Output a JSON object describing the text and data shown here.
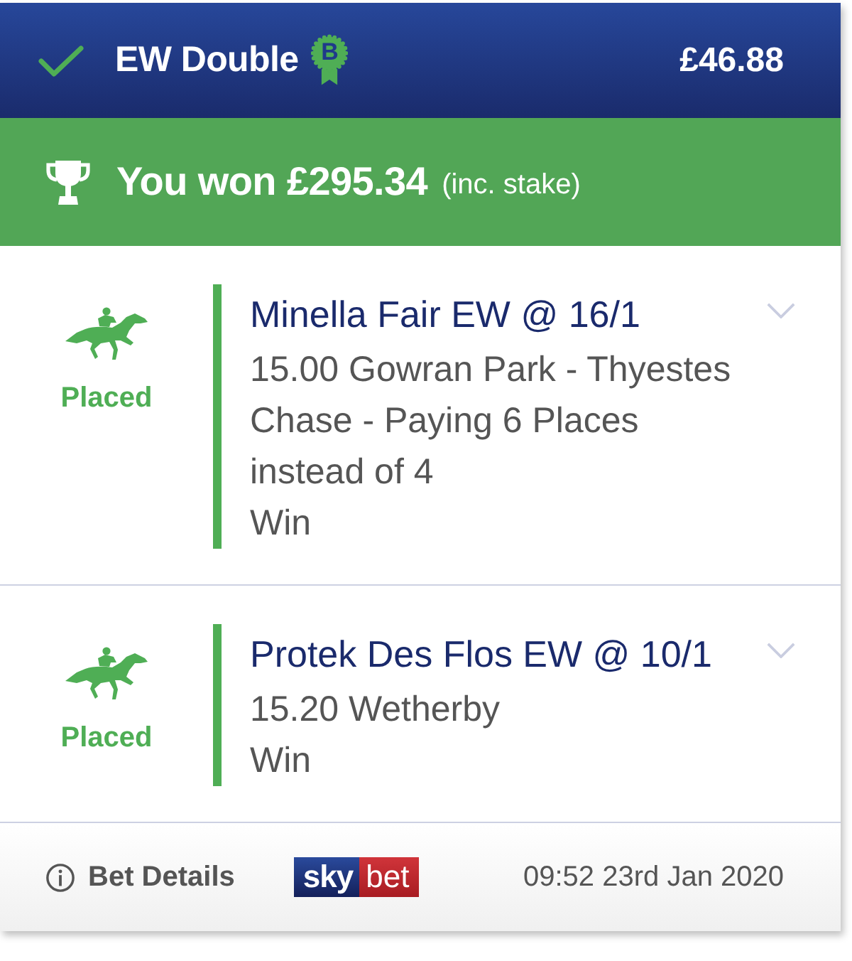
{
  "header": {
    "settled": true,
    "bet_type": "EW Double",
    "badge": "B",
    "total_stake": "£46.88"
  },
  "result_banner": {
    "headline": "You won £295.34",
    "note": "(inc. stake)"
  },
  "legs": [
    {
      "status": "Placed",
      "selection": "Minella Fair EW @ 16/1",
      "event": "15.00 Gowran Park - Thyestes Chase - Paying 6 Places instead of 4",
      "market": "Win",
      "expanded": false
    },
    {
      "status": "Placed",
      "selection": "Protek Des Flos EW @ 10/1",
      "event": "15.20 Wetherby",
      "market": "Win",
      "expanded": false
    }
  ],
  "footer": {
    "details_link": "Bet Details",
    "logo_left": "sky",
    "logo_right": "bet",
    "placed_at": "09:52 23rd Jan 2020"
  }
}
